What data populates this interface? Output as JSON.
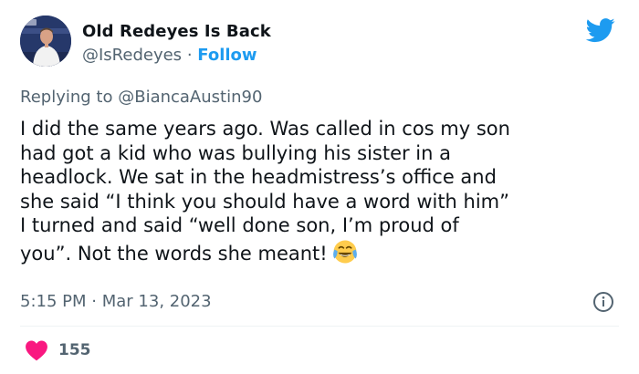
{
  "author": {
    "name": "Old Redeyes Is Back",
    "handle": "@IsRedeyes",
    "separator": "·",
    "follow_label": "Follow",
    "avatar_icon": "profile-photo"
  },
  "reply": {
    "prefix": "Replying to",
    "target": "@BiancaAustin90"
  },
  "tweet": {
    "lines": [
      "I did the same years ago. Was called in cos my son",
      "had got a kid who was bullying his sister in a",
      "headlock. We sat in the headmistress’s office and",
      "she said “I think you should have a word with him”",
      "I turned and said “well done son, I’m proud of",
      "you”. Not the words she meant!"
    ],
    "emoji": "face-with-tears-of-joy"
  },
  "meta": {
    "time": "5:15 PM",
    "separator": "·",
    "date": "Mar 13, 2023"
  },
  "actions": {
    "like_count": "155"
  },
  "colors": {
    "text": "#0f1419",
    "secondary": "#536471",
    "brand_blue": "#1d9bf0",
    "like_red": "#f91880"
  }
}
